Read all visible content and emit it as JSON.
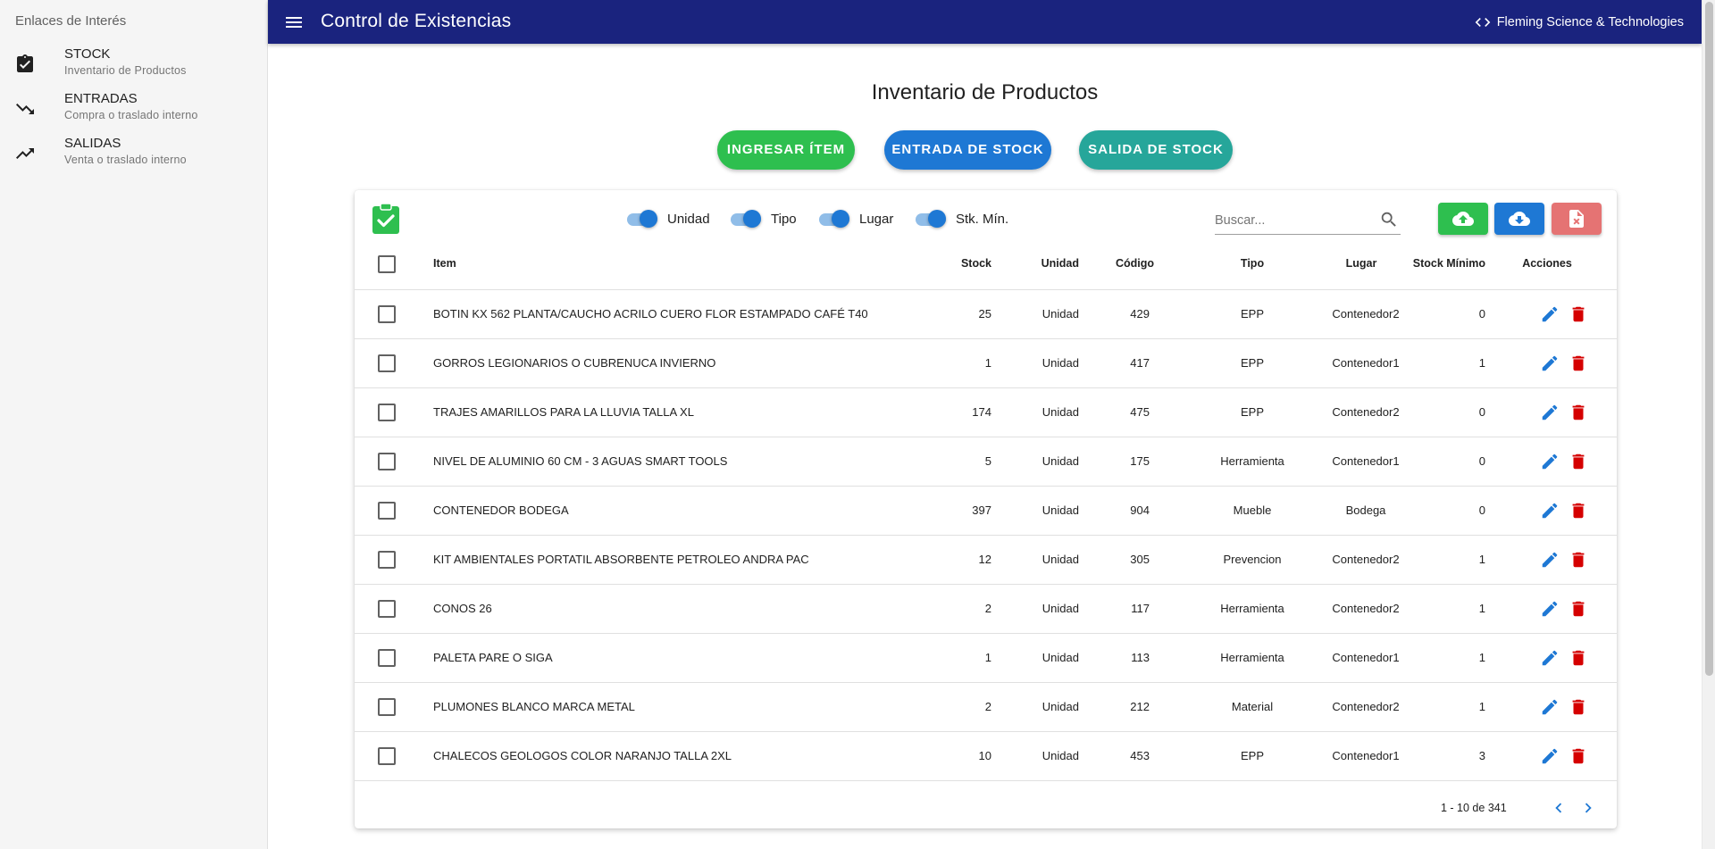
{
  "sidebar": {
    "header": "Enlaces de Interés",
    "items": [
      {
        "title": "STOCK",
        "subtitle": "Inventario de Productos",
        "icon": "clipboard-check-icon"
      },
      {
        "title": "ENTRADAS",
        "subtitle": "Compra o traslado interno",
        "icon": "trending-down-icon"
      },
      {
        "title": "SALIDAS",
        "subtitle": "Venta o traslado interno",
        "icon": "trending-up-icon"
      }
    ]
  },
  "header": {
    "title": "Control de Existencias",
    "brand": "Fleming Science & Technologies",
    "background": "#1a237e"
  },
  "main": {
    "title": "Inventario de Productos",
    "buttons": {
      "ingresar": "INGRESAR ÍTEM",
      "entrada": "ENTRADA DE STOCK",
      "salida": "SALIDA DE STOCK"
    },
    "colors": {
      "green": "#2ebf4f",
      "blue": "#1e78d4",
      "teal": "#26a69a",
      "red": "#e57373",
      "delete_red": "#d50000"
    }
  },
  "toolbar": {
    "toggles": [
      {
        "label": "Unidad",
        "on": true
      },
      {
        "label": "Tipo",
        "on": true
      },
      {
        "label": "Lugar",
        "on": true
      },
      {
        "label": "Stk. Mín.",
        "on": true
      }
    ],
    "search_placeholder": "Buscar...",
    "search_value": ""
  },
  "table": {
    "columns": [
      "Item",
      "Stock",
      "Unidad",
      "Código",
      "Tipo",
      "Lugar",
      "Stock Mínimo",
      "Acciones"
    ],
    "rows": [
      {
        "item": "BOTIN KX 562 PLANTA/CAUCHO ACRILO CUERO FLOR ESTAMPADO CAFÉ T40",
        "stock": "25",
        "unidad": "Unidad",
        "codigo": "429",
        "tipo": "EPP",
        "lugar": "Contenedor2",
        "minimo": "0"
      },
      {
        "item": "GORROS LEGIONARIOS O CUBRENUCA INVIERNO",
        "stock": "1",
        "unidad": "Unidad",
        "codigo": "417",
        "tipo": "EPP",
        "lugar": "Contenedor1",
        "minimo": "1"
      },
      {
        "item": "TRAJES AMARILLOS PARA LA LLUVIA TALLA XL",
        "stock": "174",
        "unidad": "Unidad",
        "codigo": "475",
        "tipo": "EPP",
        "lugar": "Contenedor2",
        "minimo": "0"
      },
      {
        "item": "NIVEL DE ALUMINIO 60 CM - 3 AGUAS SMART TOOLS",
        "stock": "5",
        "unidad": "Unidad",
        "codigo": "175",
        "tipo": "Herramienta",
        "lugar": "Contenedor1",
        "minimo": "0"
      },
      {
        "item": "CONTENEDOR BODEGA",
        "stock": "397",
        "unidad": "Unidad",
        "codigo": "904",
        "tipo": "Mueble",
        "lugar": "Bodega",
        "minimo": "0"
      },
      {
        "item": "KIT AMBIENTALES PORTATIL ABSORBENTE PETROLEO ANDRA PAC",
        "stock": "12",
        "unidad": "Unidad",
        "codigo": "305",
        "tipo": "Prevencion",
        "lugar": "Contenedor2",
        "minimo": "1"
      },
      {
        "item": "CONOS 26",
        "stock": "2",
        "unidad": "Unidad",
        "codigo": "117",
        "tipo": "Herramienta",
        "lugar": "Contenedor2",
        "minimo": "1"
      },
      {
        "item": "PALETA PARE O SIGA",
        "stock": "1",
        "unidad": "Unidad",
        "codigo": "113",
        "tipo": "Herramienta",
        "lugar": "Contenedor1",
        "minimo": "1"
      },
      {
        "item": "PLUMONES BLANCO MARCA METAL",
        "stock": "2",
        "unidad": "Unidad",
        "codigo": "212",
        "tipo": "Material",
        "lugar": "Contenedor2",
        "minimo": "1"
      },
      {
        "item": "CHALECOS GEOLOGOS COLOR NARANJO TALLA 2XL",
        "stock": "10",
        "unidad": "Unidad",
        "codigo": "453",
        "tipo": "EPP",
        "lugar": "Contenedor1",
        "minimo": "3"
      }
    ],
    "pagination": "1 - 10 de 341"
  }
}
